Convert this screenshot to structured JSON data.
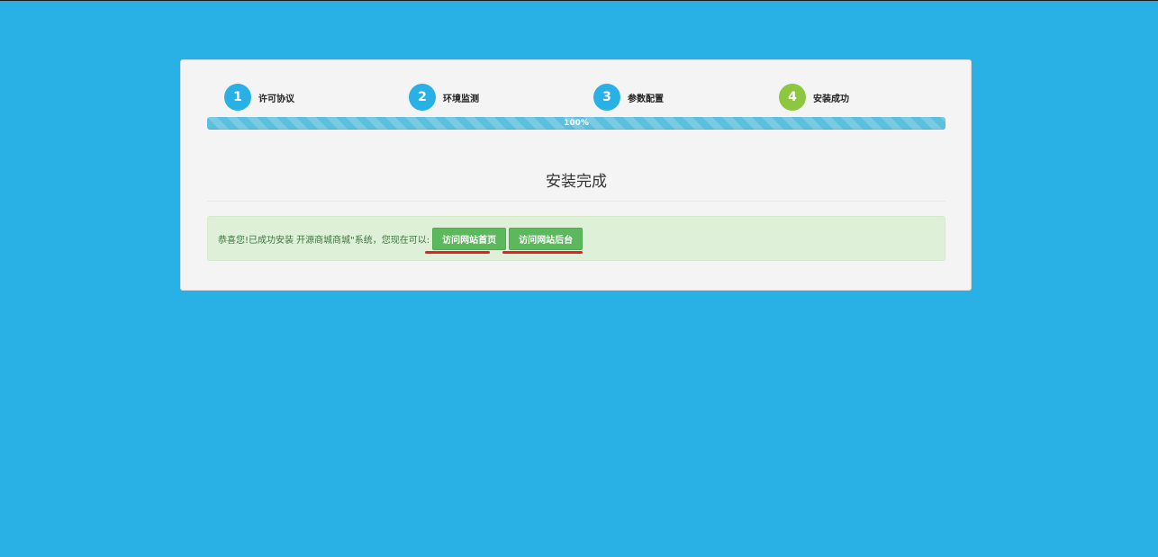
{
  "steps": [
    {
      "number": "1",
      "label": "许可协议",
      "state": "active"
    },
    {
      "number": "2",
      "label": "环境监测",
      "state": "active"
    },
    {
      "number": "3",
      "label": "参数配置",
      "state": "active"
    },
    {
      "number": "4",
      "label": "安装成功",
      "state": "done"
    }
  ],
  "progress": {
    "value": 100,
    "label": "100%"
  },
  "heading": "安装完成",
  "alert": {
    "text": "恭喜您!已成功安装 开源商城商城\"系统，您现在可以:",
    "buttons": {
      "home": "访问网站首页",
      "admin": "访问网站后台"
    }
  },
  "colors": {
    "background": "#29b0e5",
    "step_active": "#29b0e5",
    "step_done": "#8dc63f",
    "success_button": "#5cb85c",
    "annotation_underline": "#e3211f"
  }
}
